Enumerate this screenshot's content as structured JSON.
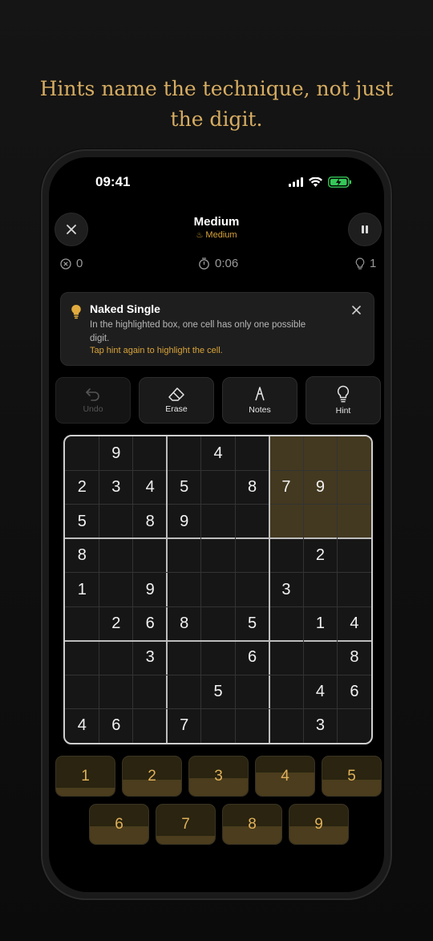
{
  "headline": {
    "line1": "Hints name the technique, not just",
    "line2": "the digit."
  },
  "status_bar": {
    "time": "09:41"
  },
  "header": {
    "title": "Medium",
    "difficulty": "Medium",
    "close_icon": "close-icon",
    "pause_icon": "pause-icon"
  },
  "stats": {
    "mistakes": "0",
    "timer": "0:06",
    "hints_used": "1"
  },
  "hint_card": {
    "title": "Naked Single",
    "body": "In the highlighted box, one cell has only one possible digit.",
    "action": "Tap hint again to highlight the cell."
  },
  "toolbar": {
    "undo": "Undo",
    "erase": "Erase",
    "notes": "Notes",
    "hint": "Hint"
  },
  "board": {
    "rows": [
      [
        "",
        "9",
        "",
        "",
        "4",
        "",
        "",
        "",
        ""
      ],
      [
        "2",
        "3",
        "4",
        "5",
        "",
        "8",
        "7",
        "9",
        ""
      ],
      [
        "5",
        "",
        "8",
        "9",
        "",
        "",
        "",
        "",
        ""
      ],
      [
        "8",
        "",
        "",
        "",
        "",
        "",
        "",
        "2",
        ""
      ],
      [
        "1",
        "",
        "9",
        "",
        "",
        "",
        "3",
        "",
        ""
      ],
      [
        "",
        "2",
        "6",
        "8",
        "",
        "5",
        "",
        "1",
        "4"
      ],
      [
        "",
        "",
        "3",
        "",
        "",
        "6",
        "",
        "",
        "8"
      ],
      [
        "",
        "",
        "",
        "",
        "5",
        "",
        "",
        "4",
        "6"
      ],
      [
        "4",
        "6",
        "",
        "7",
        "",
        "",
        "",
        "3",
        ""
      ]
    ],
    "highlighted_box": "top-right"
  },
  "number_pad": {
    "keys": [
      {
        "label": "1",
        "progress": 0.2
      },
      {
        "label": "2",
        "progress": 0.4
      },
      {
        "label": "3",
        "progress": 0.45
      },
      {
        "label": "4",
        "progress": 0.6
      },
      {
        "label": "5",
        "progress": 0.4
      },
      {
        "label": "6",
        "progress": 0.45
      },
      {
        "label": "7",
        "progress": 0.2
      },
      {
        "label": "8",
        "progress": 0.45
      },
      {
        "label": "9",
        "progress": 0.45
      }
    ]
  },
  "colors": {
    "accent": "#d9a43a",
    "headline": "#d7ad62",
    "highlight": "#433920",
    "battery": "#35c759"
  }
}
